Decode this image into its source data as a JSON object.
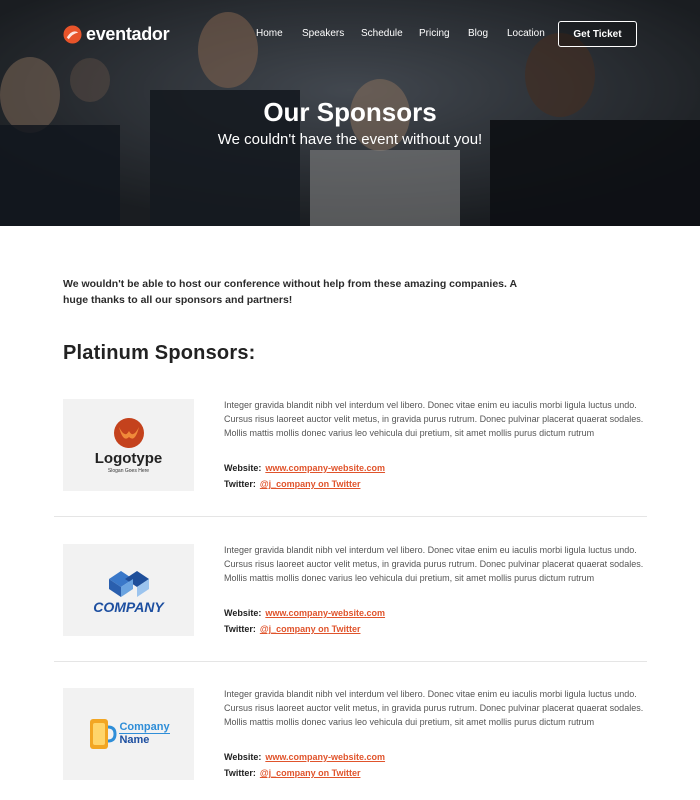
{
  "brand": {
    "name": "eventador",
    "accent": "#e8542a"
  },
  "nav": {
    "items": [
      "Home",
      "Speakers",
      "Schedule",
      "Pricing",
      "Blog",
      "Location"
    ],
    "cta": "Get Ticket"
  },
  "hero": {
    "title": "Our Sponsors",
    "subtitle": "We couldn't have the event without you!"
  },
  "intro": "We wouldn't be able to host our conference without help from these amazing companies. A huge thanks to all our sponsors and partners!",
  "section_title": "Platinum Sponsors:",
  "sponsors": [
    {
      "logo_text": "Logotype",
      "logo_slogan": "Slogan Goes Here",
      "description": "Integer gravida blandit nibh vel interdum vel libero. Donec vitae enim eu iaculis morbi ligula luctus undo. Cursus risus laoreet auctor velit metus, in gravida purus rutrum. Donec pulvinar placerat quaerat sodales. Mollis mattis mollis donec varius leo vehicula dui pretium, sit amet mollis purus dictum rutrum",
      "website_label": "Website:",
      "website": "www.company-website.com",
      "twitter_label": "Twitter:",
      "twitter": "@j_company on Twitter"
    },
    {
      "logo_text": "COMPANY",
      "description": "Integer gravida blandit nibh vel interdum vel libero. Donec vitae enim eu iaculis morbi ligula luctus undo. Cursus risus laoreet auctor velit metus, in gravida purus rutrum. Donec pulvinar placerat quaerat sodales. Mollis mattis mollis donec varius leo vehicula dui pretium, sit amet mollis purus dictum rutrum",
      "website_label": "Website:",
      "website": "www.company-website.com",
      "twitter_label": "Twitter:",
      "twitter": "@j_company on Twitter"
    },
    {
      "logo_text_1": "Company",
      "logo_text_2": "Name",
      "description": "Integer gravida blandit nibh vel interdum vel libero. Donec vitae enim eu iaculis morbi ligula luctus undo. Cursus risus laoreet auctor velit metus, in gravida purus rutrum. Donec pulvinar placerat quaerat sodales. Mollis mattis mollis donec varius leo vehicula dui pretium, sit amet mollis purus dictum rutrum",
      "website_label": "Website:",
      "website": "www.company-website.com",
      "twitter_label": "Twitter:",
      "twitter": "@j_company on Twitter"
    }
  ]
}
